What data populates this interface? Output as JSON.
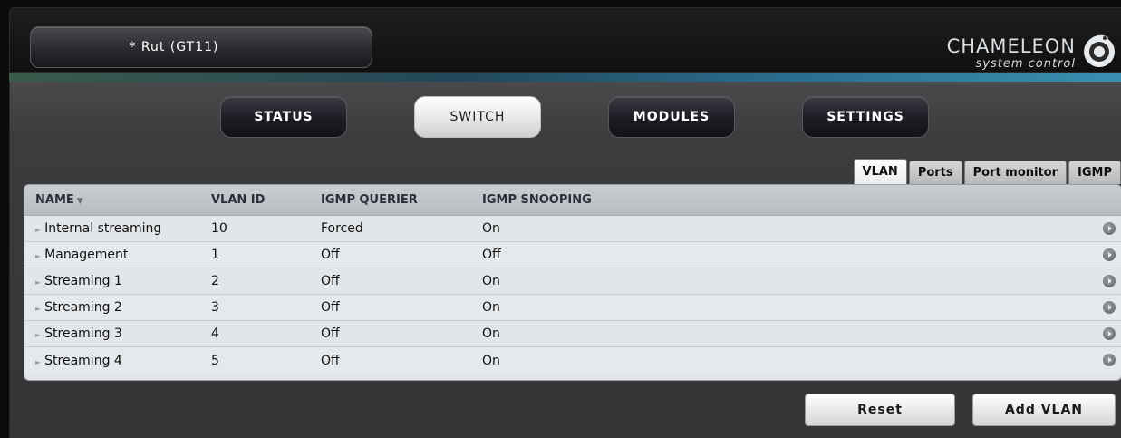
{
  "header": {
    "device_title": "* Rut (GT11)",
    "logo_word": "CHAMELEON",
    "logo_sub": "system control"
  },
  "nav": {
    "tabs": [
      {
        "label": "STATUS",
        "active": false
      },
      {
        "label": "SWITCH",
        "active": true
      },
      {
        "label": "MODULES",
        "active": false
      },
      {
        "label": "SETTINGS",
        "active": false
      }
    ]
  },
  "subtabs": [
    {
      "label": "VLAN",
      "active": true
    },
    {
      "label": "Ports",
      "active": false
    },
    {
      "label": "Port monitor",
      "active": false
    },
    {
      "label": "IGMP",
      "active": false
    }
  ],
  "table": {
    "columns": [
      "NAME",
      "VLAN ID",
      "IGMP QUERIER",
      "IGMP SNOOPING"
    ],
    "sort_indicator": "▼",
    "rows": [
      {
        "name": "Internal streaming",
        "vlan_id": "10",
        "querier": "Forced",
        "snooping": "On"
      },
      {
        "name": "Management",
        "vlan_id": "1",
        "querier": "Off",
        "snooping": "Off"
      },
      {
        "name": "Streaming 1",
        "vlan_id": "2",
        "querier": "Off",
        "snooping": "On"
      },
      {
        "name": "Streaming 2",
        "vlan_id": "3",
        "querier": "Off",
        "snooping": "On"
      },
      {
        "name": "Streaming 3",
        "vlan_id": "4",
        "querier": "Off",
        "snooping": "On"
      },
      {
        "name": "Streaming 4",
        "vlan_id": "5",
        "querier": "Off",
        "snooping": "On"
      }
    ]
  },
  "buttons": {
    "reset": "Reset",
    "add_vlan": "Add VLAN"
  }
}
